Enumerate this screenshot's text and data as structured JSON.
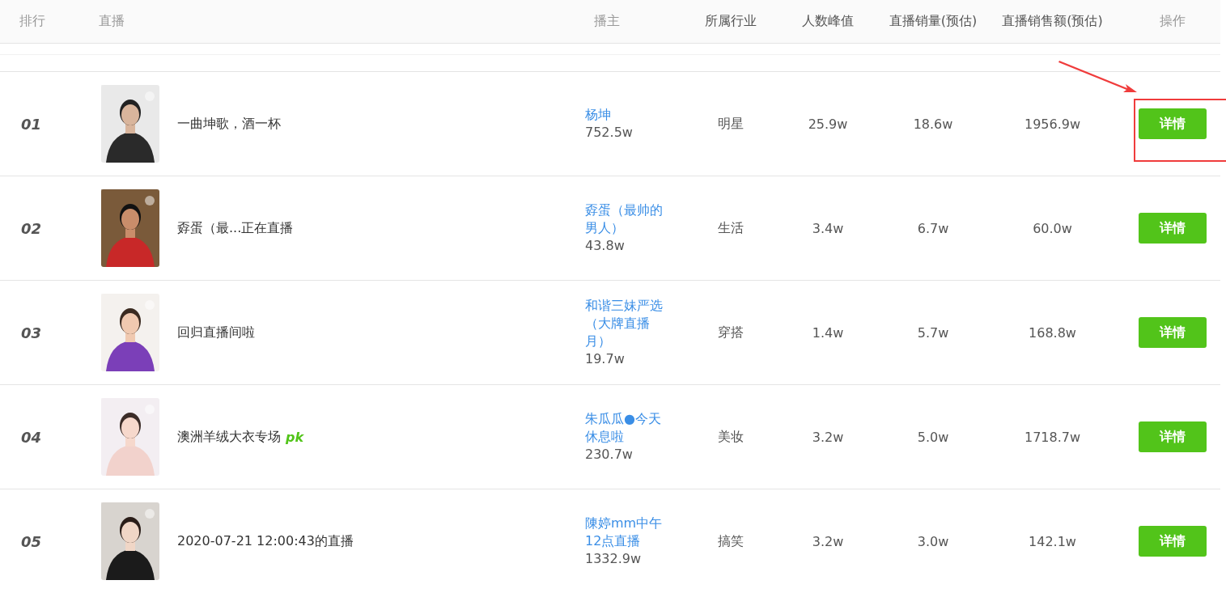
{
  "table": {
    "columns": [
      {
        "label": "排行"
      },
      {
        "label": "直播"
      },
      {
        "label": "播主"
      },
      {
        "label": "所属行业"
      },
      {
        "label": "人数峰值"
      },
      {
        "label": "直播销量(预估)"
      },
      {
        "label": "直播销售额(预估)"
      },
      {
        "label": "操作"
      }
    ],
    "rows": [
      {
        "rank": "01",
        "title": "一曲坤歌，酒一杯",
        "host": "杨坤",
        "fans": "752.5w",
        "industry": "明星",
        "peak": "25.9w",
        "sales": "18.6w",
        "revenue": "1956.9w",
        "action": "详情",
        "highlighted": true
      },
      {
        "rank": "02",
        "title": "孬蛋（最...正在直播",
        "host": "孬蛋（最帅的男人）",
        "fans": "43.8w",
        "industry": "生活",
        "peak": "3.4w",
        "sales": "6.7w",
        "revenue": "60.0w",
        "action": "详情",
        "highlighted": false
      },
      {
        "rank": "03",
        "title": "回归直播间啦",
        "host": "和谐三妹严选（大牌直播月）",
        "fans": "19.7w",
        "industry": "穿搭",
        "peak": "1.4w",
        "sales": "5.7w",
        "revenue": "168.8w",
        "action": "详情",
        "highlighted": false
      },
      {
        "rank": "04",
        "title": "澳洲羊绒大衣专场",
        "badge": "pk",
        "host": "朱瓜瓜●今天休息啦",
        "fans": "230.7w",
        "industry": "美妆",
        "peak": "3.2w",
        "sales": "5.0w",
        "revenue": "1718.7w",
        "action": "详情",
        "highlighted": false
      },
      {
        "rank": "05",
        "title": "2020-07-21 12:00:43的直播",
        "host": "陳婷mm中午12点直播",
        "fans": "1332.9w",
        "industry": "搞笑",
        "peak": "3.2w",
        "sales": "3.0w",
        "revenue": "142.1w",
        "action": "详情",
        "highlighted": false
      }
    ]
  }
}
